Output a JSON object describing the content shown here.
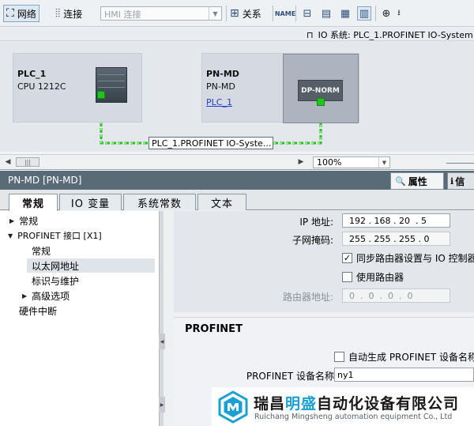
{
  "toolbar": {
    "network_label": "网络",
    "connect_label": "连接",
    "hmi_select": "HMI 连接",
    "relation_label": "关系"
  },
  "io_bar": {
    "text": "IO 系统: PLC_1.PROFINET IO-System"
  },
  "devices": {
    "plc": {
      "name": "PLC_1",
      "type": "CPU 1212C"
    },
    "pnmd": {
      "name": "PN-MD",
      "type": "PN-MD",
      "link": "PLC_1"
    },
    "dp_norm": "DP-NORM"
  },
  "network_label": "PLC_1.PROFINET IO-Syste...",
  "zoom": "100%",
  "properties": {
    "title": "PN-MD [PN-MD]",
    "tab_properties": "属性",
    "tab_info": "信"
  },
  "subtabs": [
    "常规",
    "IO 变量",
    "系统常数",
    "文本"
  ],
  "tree": {
    "items": [
      "常规",
      "PROFINET 接口 [X1]",
      "常规",
      "以太网地址",
      "标识与维护",
      "高级选项",
      "硬件中断"
    ]
  },
  "ethernet": {
    "ip_label": "IP 地址:",
    "ip_value": "192 . 168 . 20  . 5",
    "subnet_label": "子网掩码:",
    "subnet_value": "255 . 255 . 255 . 0",
    "sync_router_label": "同步路由器设置与 IO 控制器",
    "use_router_label": "使用路由器",
    "router_addr_label": "路由器地址:",
    "router_addr_value": "0  .  0  .  0  .  0"
  },
  "profinet": {
    "heading": "PROFINET",
    "auto_name_label": "自动生成 PROFINET 设备名称",
    "device_name_label": "PROFINET 设备名称",
    "device_name_value": "ny1"
  },
  "watermark": {
    "cn_pre": "瑞昌",
    "cn_hl": "明盛",
    "cn_post": "自动化设备有限公司",
    "en": "Ruichang Mingsheng automation equipment Co., Ltd"
  },
  "colors": {
    "accent_green": "#22c21f",
    "title_bar": "#5a6b78",
    "link_blue": "#1f3fd0",
    "watermark_blue": "#1aa0d2"
  }
}
